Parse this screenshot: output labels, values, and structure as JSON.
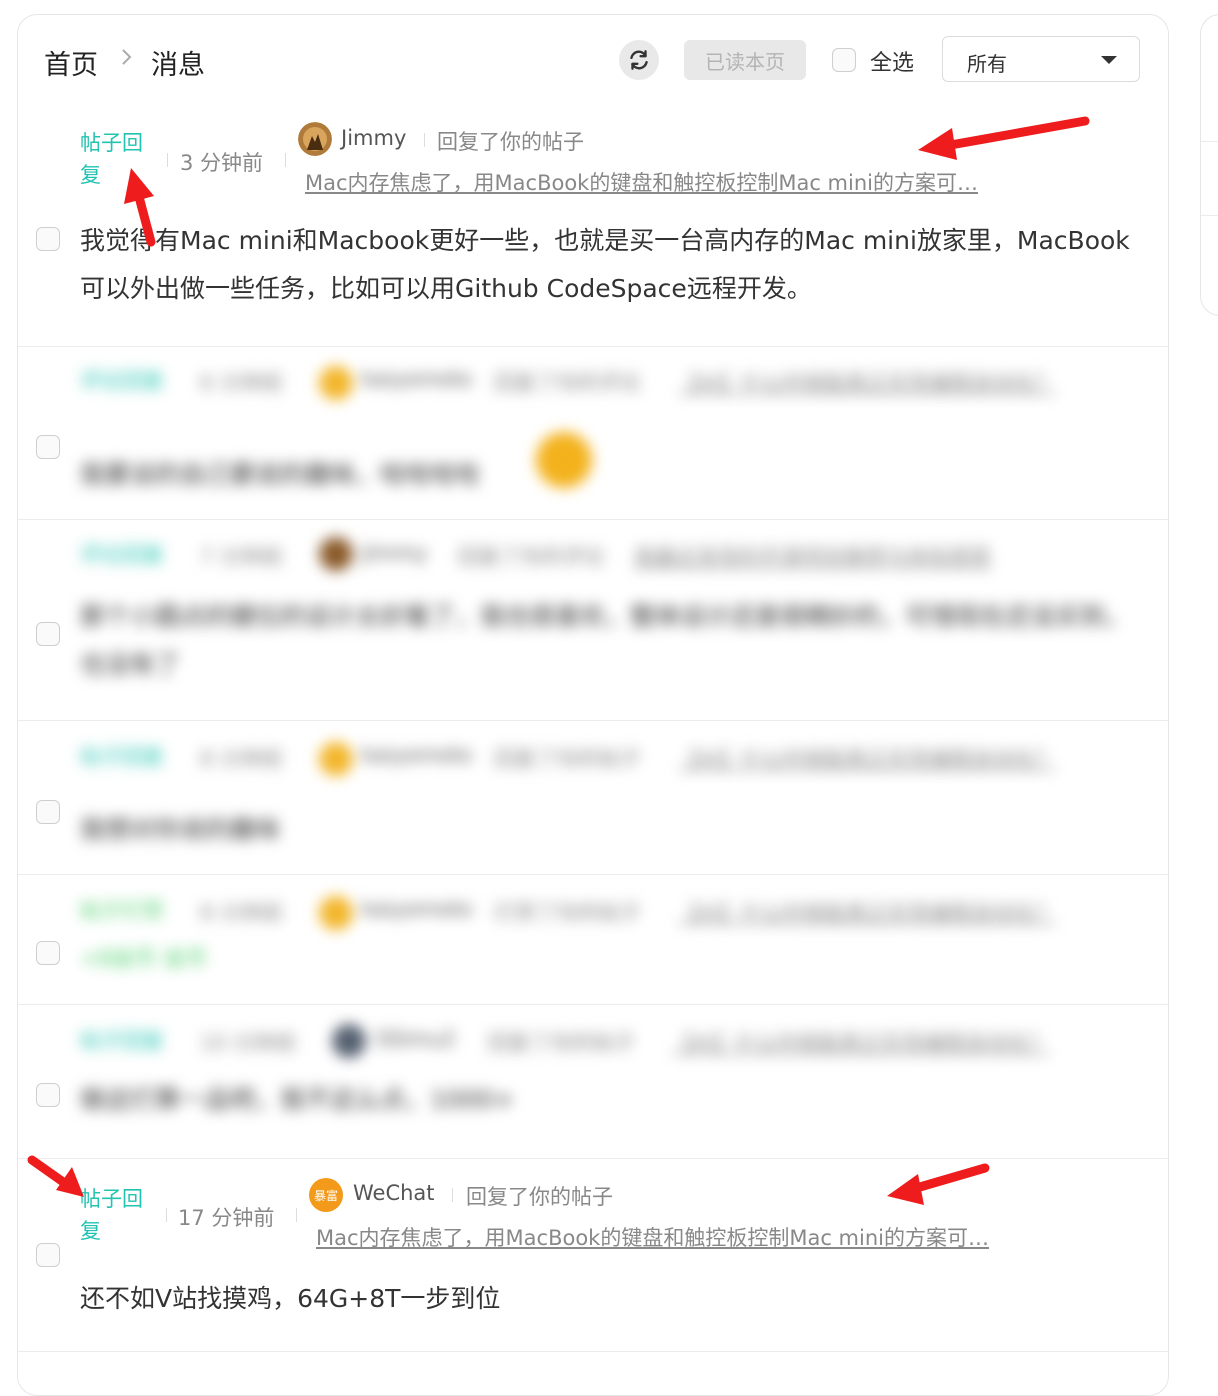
{
  "header": {
    "breadcrumb_home": "首页",
    "breadcrumb_current": "消息",
    "mark_read_label": "已读本页",
    "select_all_label": "全选",
    "filter_value": "所有"
  },
  "messages": [
    {
      "type": "帖子回复",
      "time": "3 分钟前",
      "user": "Jimmy",
      "action": "回复了你的帖子",
      "post_title": "Mac内存焦虑了，用MacBook的键盘和触控板控制Mac mini的方案可…",
      "content": "我觉得有Mac mini和Macbook更好一些，也就是买一台高内存的Mac mini放家里，MacBook可以外出做一些任务，比如可以用Github CodeSpace远程开发。",
      "blurred": false
    },
    {
      "type": "评论回复",
      "time": "6 分钟前",
      "user": "kaiyomoto",
      "action": "回复了你的评论",
      "post_title": "【AI】什么时候能真正实现编程自动化？",
      "content": "我要谈的自己要说的趣味，哈哈哈哈",
      "blurred": true
    },
    {
      "type": "评论回复",
      "time": "7 分钟前",
      "user": "Jimmy",
      "action": "回复了你的评论",
      "post_title": "我最近发现的开源项目推荐与体验感受",
      "content": "那个小圆点的键位的设计太好看了，我也很喜欢，整体设计还是很精妙的，可惜现在还没买到，也没有了",
      "blurred": true
    },
    {
      "type": "帖子回复",
      "time": "8 分钟前",
      "user": "kaiyomoto",
      "action": "回复了你的帖子",
      "post_title": "【AI】什么时候能真正实现编程自动化？",
      "content": "我想对你说的趣味",
      "blurred": true
    },
    {
      "type": "帖子打赏",
      "time": "8 分钟前",
      "user": "kaiyomoto",
      "action": "打赏了你的帖子",
      "post_title": "【AI】什么时候能真正实现编程自动化？",
      "content": "+8金币 金币",
      "blurred": true
    },
    {
      "type": "帖子回复",
      "time": "10 分钟前",
      "user": "SSimu2",
      "action": "回复了你的帖子",
      "post_title": "【AI】什么时候能真正实现编程自动化？",
      "content": "做这打算一品吧，我不这么点，1000+",
      "blurred": true
    },
    {
      "type": "帖子回复",
      "time": "17 分钟前",
      "user": "WeChat",
      "avatar_text": "暴富",
      "action": "回复了你的帖子",
      "post_title": "Mac内存焦虑了，用MacBook的键盘和触控板控制Mac mini的方案可…",
      "content": "还不如V站找摸鸡，64G+8T一步到位",
      "blurred": false
    }
  ],
  "colors": {
    "type_label": "#23c3b1",
    "reward_label": "#4ccf6a",
    "annotation_arrow": "#ee1c1c"
  }
}
